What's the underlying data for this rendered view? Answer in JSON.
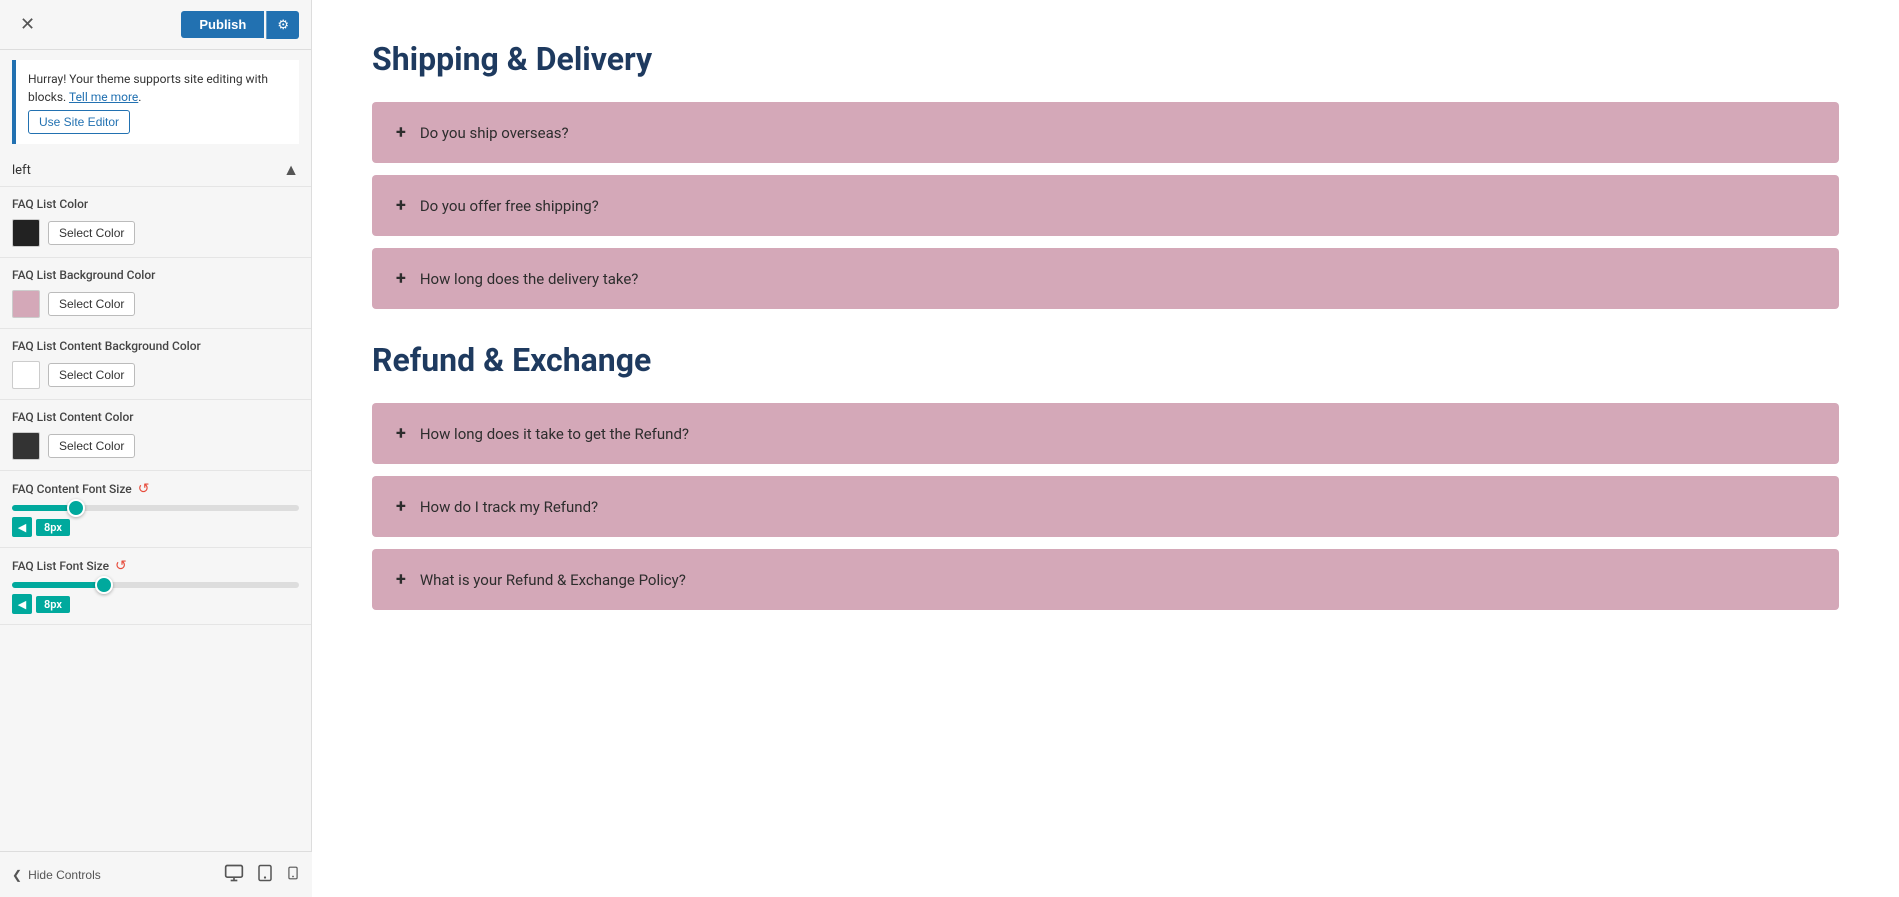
{
  "header": {
    "close_label": "✕",
    "publish_label": "Publish",
    "gear_label": "⚙"
  },
  "notice": {
    "text": "Hurray! Your theme supports site editing with blocks.",
    "link_text": "Tell me more",
    "button_label": "Use Site Editor"
  },
  "alignment": {
    "value": "left",
    "arrow": "▲"
  },
  "color_sections": [
    {
      "id": "faq-list-color",
      "label": "FAQ List Color",
      "swatch_color": "#222222",
      "button_label": "Select Color"
    },
    {
      "id": "faq-list-bg-color",
      "label": "FAQ List Background Color",
      "swatch_color": "#d4a8b8",
      "button_label": "Select Color"
    },
    {
      "id": "faq-list-content-bg-color",
      "label": "FAQ List Content Background Color",
      "swatch_color": "#ffffff",
      "button_label": "Select Color"
    },
    {
      "id": "faq-list-content-color",
      "label": "FAQ List Content Color",
      "swatch_color": "#333333",
      "button_label": "Select Color"
    }
  ],
  "font_size_sections": [
    {
      "id": "faq-content-font-size",
      "label": "FAQ Content Font Size",
      "value": "8px",
      "fill_percent": 20
    },
    {
      "id": "faq-list-font-size",
      "label": "FAQ List Font Size",
      "value": "8px",
      "fill_percent": 30
    }
  ],
  "bottom_bar": {
    "hide_controls_label": "Hide Controls",
    "chevron_left": "❮",
    "desktop_icon": "🖥",
    "tablet_icon": "📋",
    "mobile_icon": "📱"
  },
  "main": {
    "sections": [
      {
        "title": "Shipping & Delivery",
        "faqs": [
          "Do you ship overseas?",
          "Do you offer free shipping?",
          "How long does the delivery take?"
        ]
      },
      {
        "title": "Refund & Exchange",
        "faqs": [
          "How long does it take to get the Refund?",
          "How do I track my Refund?",
          "What is your Refund & Exchange Policy?"
        ]
      }
    ]
  }
}
